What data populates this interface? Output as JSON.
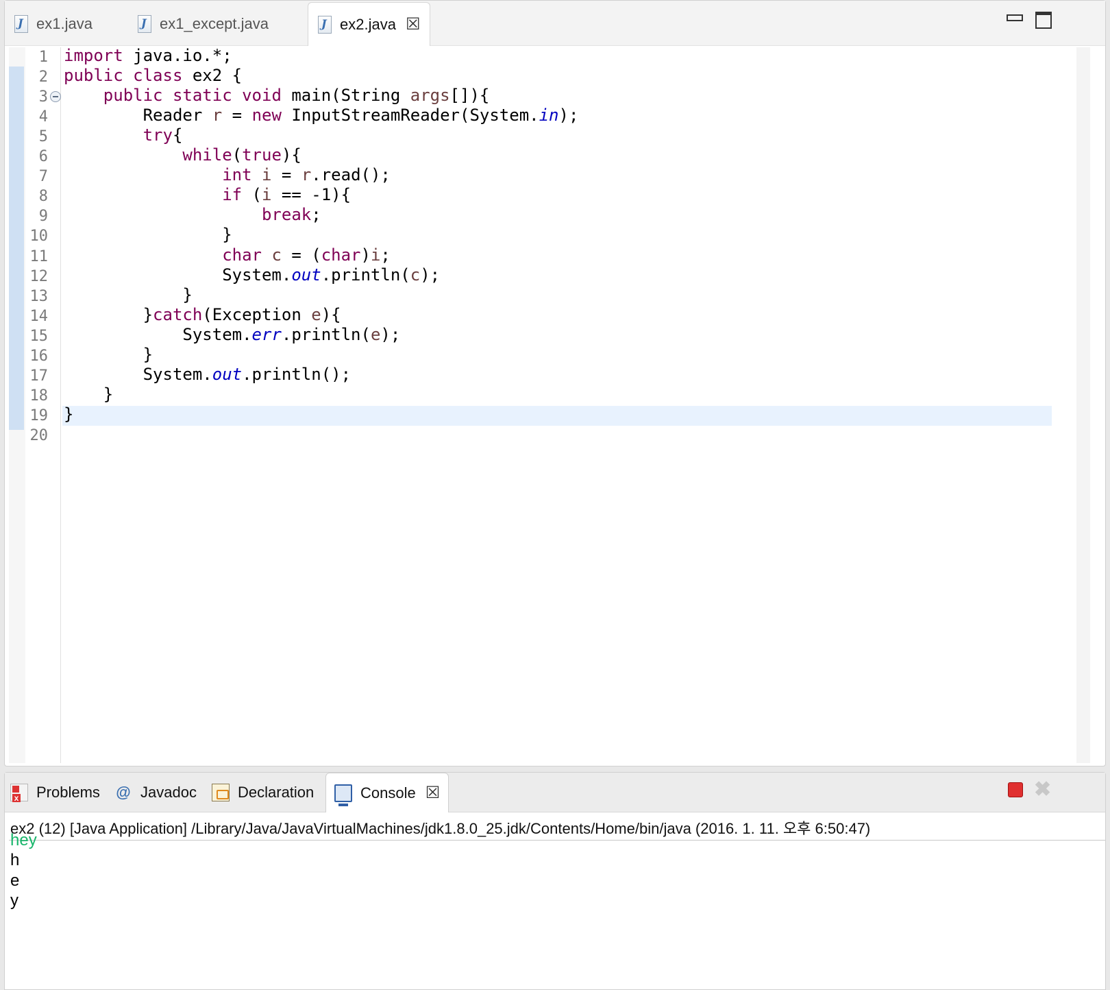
{
  "editor": {
    "tabs": [
      {
        "label": "ex1.java",
        "active": false
      },
      {
        "label": "ex1_except.java",
        "active": false
      },
      {
        "label": "ex2.java",
        "active": true
      }
    ],
    "close_glyph": "☒",
    "line_numbers": [
      "1",
      "2",
      "3",
      "4",
      "5",
      "6",
      "7",
      "8",
      "9",
      "10",
      "11",
      "12",
      "13",
      "14",
      "15",
      "16",
      "17",
      "18",
      "19",
      "20"
    ],
    "current_line": "19",
    "code_lines": [
      "import java.io.*;",
      "public class ex2 {",
      "    public static void main(String args[]){",
      "        Reader r = new InputStreamReader(System.in);",
      "        try{",
      "            while(true){",
      "                int i = r.read();",
      "                if (i == -1){",
      "                    break;",
      "                }",
      "                char c = (char)i;",
      "                System.out.println(c);",
      "            }",
      "        }catch(Exception e){",
      "            System.err.println(e);",
      "        }",
      "        System.out.println();",
      "    }",
      "}",
      ""
    ]
  },
  "views": {
    "tabs": [
      {
        "label": "Problems",
        "icon": "problems-icon"
      },
      {
        "label": "Javadoc",
        "icon": "javadoc-icon"
      },
      {
        "label": "Declaration",
        "icon": "declaration-icon"
      },
      {
        "label": "Console",
        "icon": "console-icon",
        "active": true
      }
    ],
    "javadoc_glyph": "@",
    "remove_glyph": "✖"
  },
  "console": {
    "header": "ex2 (12) [Java Application] /Library/Java/JavaVirtualMachines/jdk1.8.0_25.jdk/Contents/Home/bin/java (2016. 1. 11. 오후 6:50:47)",
    "input_line": "hey",
    "output_lines": [
      "h",
      "e",
      "y"
    ],
    "colors": {
      "input": "#17b56a",
      "output": "#000000"
    }
  },
  "syntax_colors": {
    "keyword": "#7f0055",
    "field": "#0000c0",
    "variable": "#6a3e3e",
    "current_line_bg": "#e8f2fe"
  }
}
